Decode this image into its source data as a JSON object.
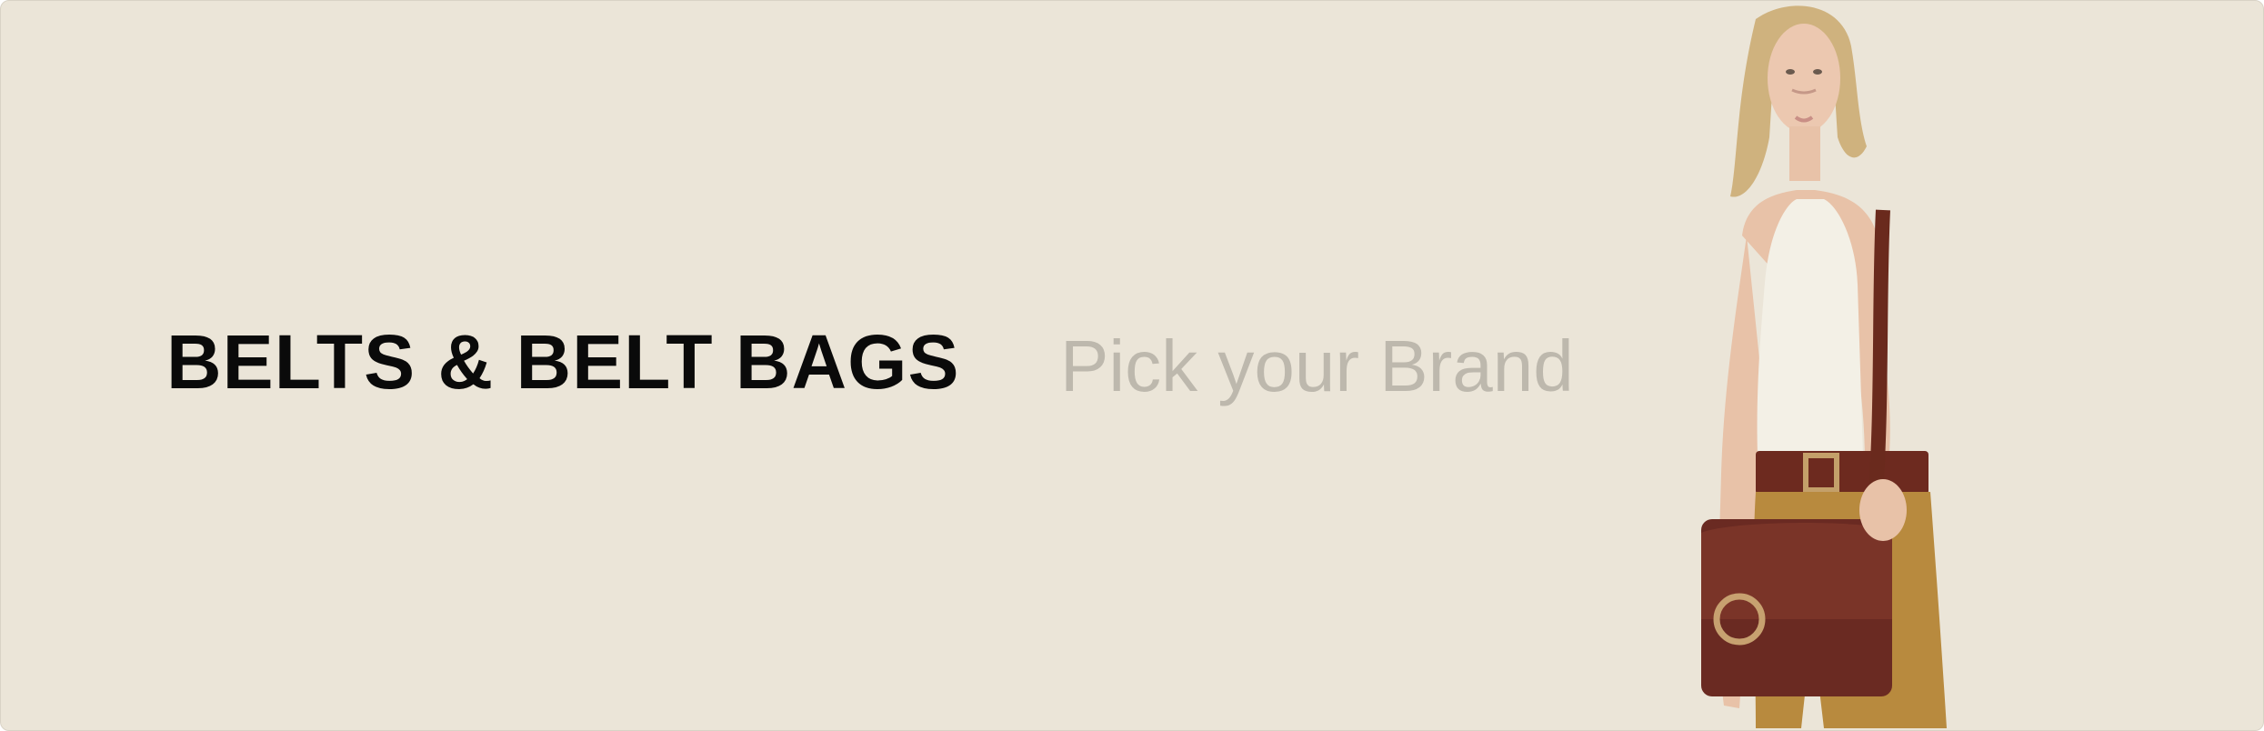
{
  "banner": {
    "headline": "BELTS & BELT BAGS",
    "brand_picker_label": "Pick your Brand",
    "background_color": "#ebe5d8",
    "headline_color": "#0a0a0a",
    "brand_picker_color": "#bdb8ad"
  },
  "hero_image": {
    "icon": "model-with-crossbody-bag-image"
  }
}
